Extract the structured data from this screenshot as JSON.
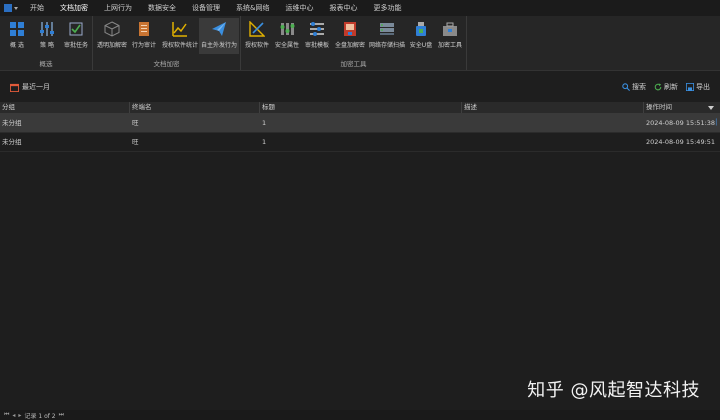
{
  "menu": {
    "items": [
      {
        "label": "开始",
        "name": "menu-start"
      },
      {
        "label": "文档加密",
        "name": "menu-doc-encrypt",
        "active": true
      },
      {
        "label": "上网行为",
        "name": "menu-internet"
      },
      {
        "label": "数据安全",
        "name": "menu-data-security"
      },
      {
        "label": "设备管理",
        "name": "menu-device"
      },
      {
        "label": "系统&网络",
        "name": "menu-system-network"
      },
      {
        "label": "运维中心",
        "name": "menu-ops"
      },
      {
        "label": "报表中心",
        "name": "menu-report"
      },
      {
        "label": "更多功能",
        "name": "menu-more"
      }
    ]
  },
  "ribbon": {
    "groups": [
      {
        "label": "概选",
        "buttons": [
          {
            "label": "概 选",
            "icon": "grid-icon"
          },
          {
            "label": "策 略",
            "icon": "sliders-icon"
          },
          {
            "label": "审批任务",
            "icon": "checklist-icon"
          }
        ]
      },
      {
        "label": "文档加密",
        "buttons": [
          {
            "label": "透明加解密",
            "icon": "cube-icon"
          },
          {
            "label": "行为审计",
            "icon": "audit-icon"
          },
          {
            "label": "授权软件统计",
            "icon": "chart-icon"
          },
          {
            "label": "自主外发行为",
            "icon": "paper-plane-icon",
            "selected": true
          }
        ]
      },
      {
        "label": "加密工具",
        "buttons": [
          {
            "label": "授权软件",
            "icon": "pen-ruler-icon"
          },
          {
            "label": "安全属性",
            "icon": "security-attr-icon"
          },
          {
            "label": "审批模板",
            "icon": "template-icon"
          },
          {
            "label": "全盘加解密",
            "icon": "disk-encrypt-icon"
          },
          {
            "label": "网络存储扫描",
            "icon": "network-scan-icon"
          },
          {
            "label": "安全U盘",
            "icon": "usb-icon"
          },
          {
            "label": "加密工具",
            "icon": "toolbox-icon"
          }
        ]
      }
    ]
  },
  "toolbar": {
    "recent": "最近一月",
    "search": "搜索",
    "refresh": "刷新",
    "export": "导出"
  },
  "table": {
    "columns": [
      "分组",
      "终端名",
      "标题",
      "描述",
      "操作时间"
    ],
    "rows": [
      {
        "group": "未分组",
        "terminal": "旺",
        "title": "1",
        "desc": "",
        "time": "2024-08-09 15:51:38"
      },
      {
        "group": "未分组",
        "terminal": "旺",
        "title": "1",
        "desc": "",
        "time": "2024-08-09 15:49:51"
      }
    ]
  },
  "pager": {
    "label": "记录 1 of 2"
  },
  "watermark": "知乎 @风起智达科技"
}
